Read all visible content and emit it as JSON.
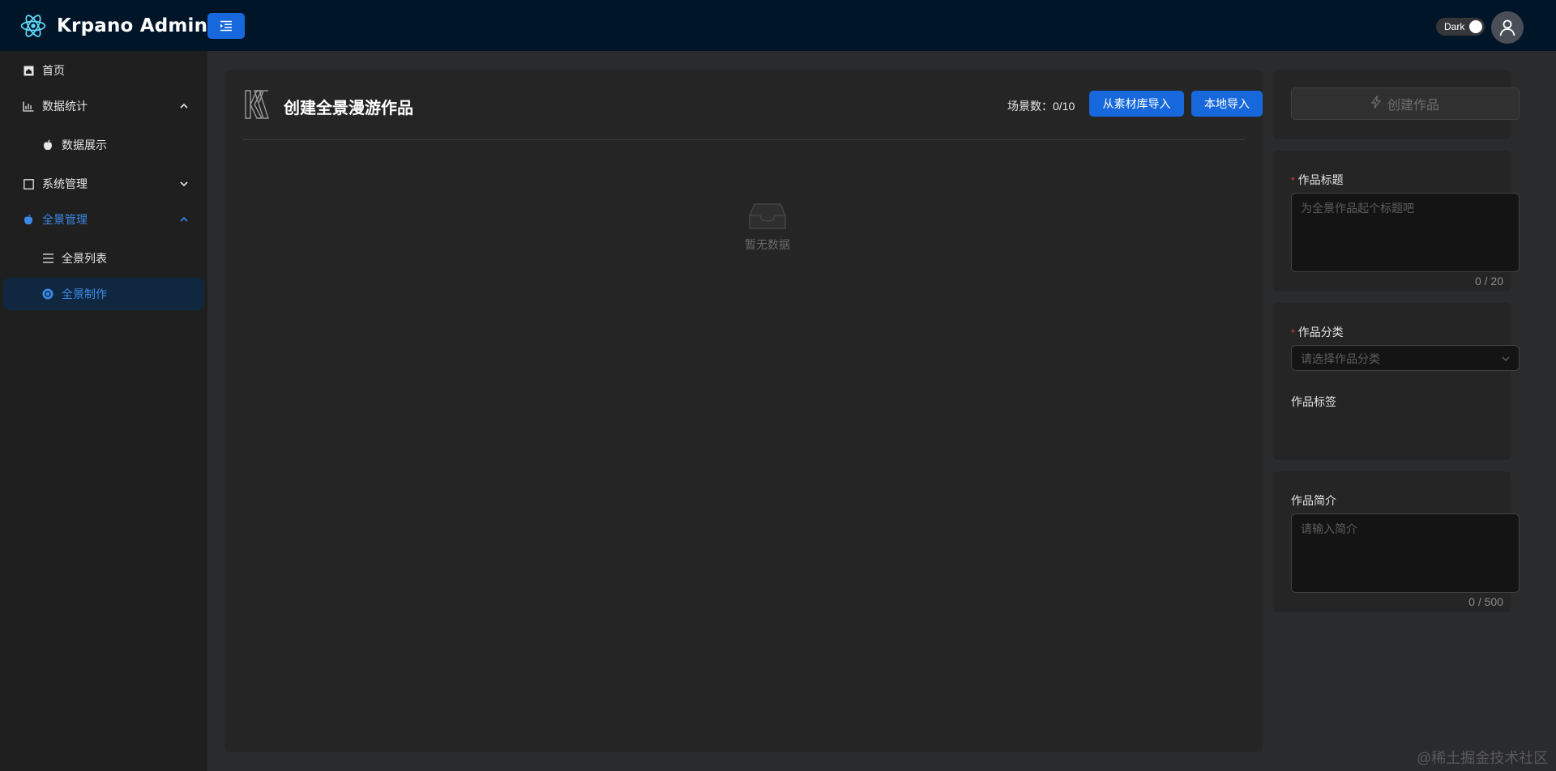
{
  "header": {
    "app_title": "Krpano Admin",
    "theme_label": "Dark",
    "brand_color": "#1668dc",
    "logo_icon": "react-atom-icon",
    "menu_toggle_icon": "menu-fold-icon",
    "avatar_icon": "user-icon"
  },
  "sidebar": {
    "items": [
      {
        "label": "首页",
        "icon": "home-icon"
      },
      {
        "label": "数据统计",
        "icon": "bar-chart-icon",
        "expanded": true
      },
      {
        "label": "数据展示",
        "icon": "apple-icon"
      },
      {
        "label": "系统管理",
        "icon": "square-icon",
        "expanded": false
      },
      {
        "label": "全景管理",
        "icon": "apple-icon",
        "expanded": true,
        "active": true
      },
      {
        "label": "全景列表",
        "icon": "list-icon"
      },
      {
        "label": "全景制作",
        "icon": "panorama-icon",
        "selected": true
      }
    ]
  },
  "main": {
    "title": "创建全景漫游作品",
    "scene_count_label": "场景数：",
    "scene_count_value": "0/10",
    "import_library_button": "从素材库导入",
    "import_local_button": "本地导入",
    "empty_text": "暂无数据"
  },
  "form": {
    "create_button": "创建作品",
    "title_label": "作品标题",
    "title_placeholder": "为全景作品起个标题吧",
    "title_counter": "0 / 20",
    "category_label": "作品分类",
    "category_placeholder": "请选择作品分类",
    "tags_label": "作品标签",
    "desc_label": "作品简介",
    "desc_placeholder": "请输入简介",
    "desc_counter": "0 / 500"
  },
  "watermark": "@稀土掘金技术社区"
}
